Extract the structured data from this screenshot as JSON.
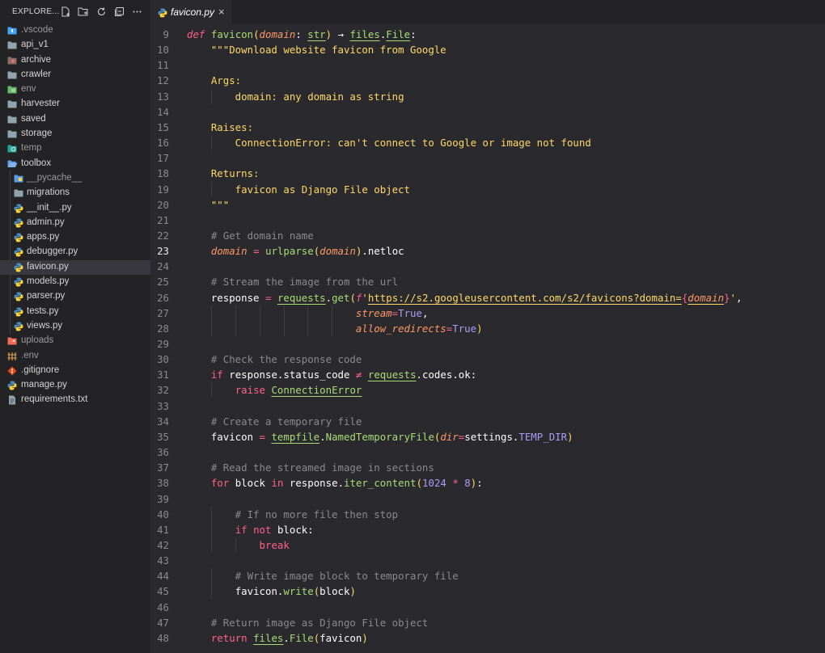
{
  "explorer": {
    "title": "EXPLORE...",
    "items": [
      {
        "label": ".vscode",
        "icon": "vscode-folder-icon",
        "depth": 0,
        "dim": true
      },
      {
        "label": "api_v1",
        "icon": "folder-icon",
        "depth": 0
      },
      {
        "label": "archive",
        "icon": "archive-folder-icon",
        "depth": 0
      },
      {
        "label": "crawler",
        "icon": "folder-icon",
        "depth": 0
      },
      {
        "label": "env",
        "icon": "env-folder-icon",
        "depth": 0,
        "dim": true
      },
      {
        "label": "harvester",
        "icon": "folder-icon",
        "depth": 0
      },
      {
        "label": "saved",
        "icon": "folder-icon",
        "depth": 0
      },
      {
        "label": "storage",
        "icon": "folder-icon",
        "depth": 0
      },
      {
        "label": "temp",
        "icon": "temp-folder-icon",
        "depth": 0,
        "dim": true
      },
      {
        "label": "toolbox",
        "icon": "folder-open-icon",
        "depth": 0
      },
      {
        "label": "__pycache__",
        "icon": "pycache-folder-icon",
        "depth": 1,
        "dim": true
      },
      {
        "label": "migrations",
        "icon": "folder-icon",
        "depth": 1
      },
      {
        "label": "__init__.py",
        "icon": "python-file-icon",
        "depth": 1
      },
      {
        "label": "admin.py",
        "icon": "python-file-icon",
        "depth": 1
      },
      {
        "label": "apps.py",
        "icon": "python-file-icon",
        "depth": 1
      },
      {
        "label": "debugger.py",
        "icon": "python-file-icon",
        "depth": 1
      },
      {
        "label": "favicon.py",
        "icon": "python-file-icon",
        "depth": 1,
        "active": true
      },
      {
        "label": "models.py",
        "icon": "python-file-icon",
        "depth": 1
      },
      {
        "label": "parser.py",
        "icon": "python-file-icon",
        "depth": 1
      },
      {
        "label": "tests.py",
        "icon": "python-file-icon",
        "depth": 1
      },
      {
        "label": "views.py",
        "icon": "python-file-icon",
        "depth": 1
      },
      {
        "label": "uploads",
        "icon": "uploads-folder-icon",
        "depth": 0,
        "dim": true
      },
      {
        "label": ".env",
        "icon": "env-file-icon",
        "depth": 0,
        "dim": true
      },
      {
        "label": ".gitignore",
        "icon": "git-icon",
        "depth": 0
      },
      {
        "label": "manage.py",
        "icon": "python-file-icon",
        "depth": 0
      },
      {
        "label": "requirements.txt",
        "icon": "text-file-icon",
        "depth": 0
      }
    ],
    "actions": [
      "new-file-icon",
      "new-folder-icon",
      "refresh-icon",
      "collapse-icon",
      "more-icon"
    ]
  },
  "tab": {
    "label": "favicon.py",
    "close": "×"
  },
  "editor": {
    "current_line": 23,
    "lines": [
      {
        "n": "9",
        "t": "def favicon(domain: str) → files.File:"
      },
      {
        "n": "10",
        "t": "    \"\"\"Download website favicon from Google"
      },
      {
        "n": "11",
        "t": ""
      },
      {
        "n": "12",
        "t": "    Args:"
      },
      {
        "n": "13",
        "t": "        domain: any domain as string"
      },
      {
        "n": "14",
        "t": ""
      },
      {
        "n": "15",
        "t": "    Raises:"
      },
      {
        "n": "16",
        "t": "        ConnectionError: can't connect to Google or image not found"
      },
      {
        "n": "17",
        "t": ""
      },
      {
        "n": "18",
        "t": "    Returns:"
      },
      {
        "n": "19",
        "t": "        favicon as Django File object"
      },
      {
        "n": "20",
        "t": "    \"\"\""
      },
      {
        "n": "21",
        "t": ""
      },
      {
        "n": "22",
        "t": "    # Get domain name"
      },
      {
        "n": "23",
        "t": "    domain = urlparse(domain).netloc"
      },
      {
        "n": "24",
        "t": ""
      },
      {
        "n": "25",
        "t": "    # Stream the image from the url"
      },
      {
        "n": "26",
        "t": "    response = requests.get(f'https://s2.googleusercontent.com/s2/favicons?domain={domain}',"
      },
      {
        "n": "27",
        "t": "                            stream=True,"
      },
      {
        "n": "28",
        "t": "                            allow_redirects=True)"
      },
      {
        "n": "29",
        "t": ""
      },
      {
        "n": "30",
        "t": "    # Check the response code"
      },
      {
        "n": "31",
        "t": "    if response.status_code ≠ requests.codes.ok:"
      },
      {
        "n": "32",
        "t": "        raise ConnectionError"
      },
      {
        "n": "33",
        "t": ""
      },
      {
        "n": "34",
        "t": "    # Create a temporary file"
      },
      {
        "n": "35",
        "t": "    favicon = tempfile.NamedTemporaryFile(dir=settings.TEMP_DIR)"
      },
      {
        "n": "36",
        "t": ""
      },
      {
        "n": "37",
        "t": "    # Read the streamed image in sections"
      },
      {
        "n": "38",
        "t": "    for block in response.iter_content(1024 * 8):"
      },
      {
        "n": "39",
        "t": ""
      },
      {
        "n": "40",
        "t": "        # If no more file then stop"
      },
      {
        "n": "41",
        "t": "        if not block:"
      },
      {
        "n": "42",
        "t": "            break"
      },
      {
        "n": "43",
        "t": ""
      },
      {
        "n": "44",
        "t": "        # Write image block to temporary file"
      },
      {
        "n": "45",
        "t": "        favicon.write(block)"
      },
      {
        "n": "46",
        "t": ""
      },
      {
        "n": "47",
        "t": "    # Return image as Django File object"
      },
      {
        "n": "48",
        "t": "    return files.File(favicon)"
      }
    ]
  },
  "colors": {
    "keyword": "#ff6188",
    "function": "#a9dc76",
    "parameter": "#fc9867",
    "string": "#ffd866",
    "comment": "#8a8a8a",
    "number": "#ab9df2",
    "background": "#2a2a2e",
    "sidebar": "#232326"
  }
}
